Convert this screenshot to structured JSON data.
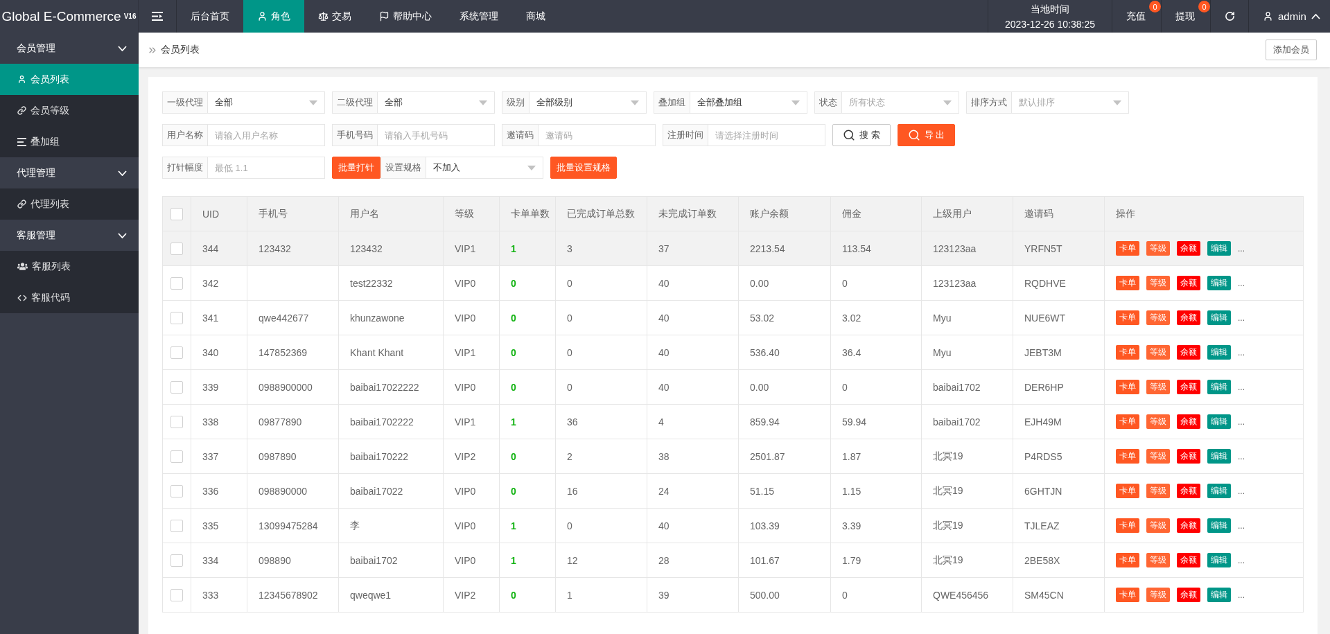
{
  "header": {
    "logo": "Global E-Commerce",
    "version": "V16",
    "nav": [
      {
        "label": "后台首页",
        "selected": false
      },
      {
        "label": "角色",
        "selected": true
      },
      {
        "label": "交易",
        "selected": false
      },
      {
        "label": "帮助中心",
        "selected": false
      },
      {
        "label": "系统管理",
        "selected": false
      },
      {
        "label": "商城",
        "selected": false
      }
    ],
    "clock": {
      "label": "当地时间",
      "time": "2023-12-26 10:38:25"
    },
    "links": [
      {
        "label": "充值",
        "badge": "0"
      },
      {
        "label": "提现",
        "badge": "0"
      }
    ],
    "user": "admin"
  },
  "sidebar": [
    {
      "label": "会员管理",
      "expanded": true,
      "children": [
        {
          "label": "会员列表",
          "selected": true
        },
        {
          "label": "会员等级",
          "selected": false
        },
        {
          "label": "叠加组",
          "selected": false
        }
      ]
    },
    {
      "label": "代理管理",
      "expanded": true,
      "children": [
        {
          "label": "代理列表",
          "selected": false
        }
      ]
    },
    {
      "label": "客服管理",
      "expanded": true,
      "children": [
        {
          "label": "客服列表",
          "selected": false
        },
        {
          "label": "客服代码",
          "selected": false
        }
      ]
    }
  ],
  "breadcrumb": {
    "current": "会员列表",
    "add_button": "添加会员"
  },
  "filters": [
    [
      {
        "kind": "select",
        "label": "一级代理",
        "value": "全部"
      },
      {
        "kind": "select",
        "label": "二级代理",
        "value": "全部"
      },
      {
        "kind": "select",
        "label": "级别",
        "value": "全部级别"
      },
      {
        "kind": "select",
        "label": "叠加组",
        "value": "全部叠加组"
      },
      {
        "kind": "select",
        "label": "状态",
        "placeholder": "所有状态"
      },
      {
        "kind": "select",
        "label": "排序方式",
        "placeholder": "默认排序"
      }
    ],
    [
      {
        "kind": "input",
        "label": "用户名称",
        "placeholder": "请输入用户名称"
      },
      {
        "kind": "input",
        "label": "手机号码",
        "placeholder": "请输入手机号码"
      },
      {
        "kind": "input",
        "label": "邀请码",
        "placeholder": "邀请码"
      },
      {
        "kind": "input",
        "label": "注册时间",
        "placeholder": "请选择注册时间"
      },
      {
        "kind": "plainbutton",
        "icon": true,
        "label": "搜 索"
      },
      {
        "kind": "button",
        "icon": true,
        "label": "导 出"
      }
    ],
    [
      {
        "kind": "input",
        "label": "打针幅度",
        "placeholder": "最低 1.1"
      },
      {
        "kind": "group",
        "items": [
          {
            "kind": "button",
            "label": "批量打针"
          },
          {
            "kind": "select",
            "label": "设置规格",
            "value": "不加入"
          }
        ]
      },
      {
        "kind": "button",
        "label": "批量设置规格"
      }
    ]
  ],
  "table": {
    "header_checked": false,
    "columns": [
      "UID",
      "手机号",
      "用户名",
      "等级",
      "卡单单数",
      "已完成订单总数",
      "未完成订单数",
      "账户余额",
      "佣金",
      "上级用户",
      "邀请码",
      "操作"
    ],
    "rows": [
      {
        "checked": false,
        "highlighted": true,
        "uid": "344",
        "phone": "123432",
        "username": "123432",
        "level": "VIP1",
        "stuck": "1",
        "done": "3",
        "pending": "37",
        "balance": "2213.54",
        "commission": "113.54",
        "parent": "123123aa",
        "invite": "YRFN5T",
        "actions": [
          {
            "label": "卡单",
            "color": "#ff5722"
          },
          {
            "label": "等级",
            "color": "#ff6633"
          },
          {
            "label": "余额",
            "color": "#ff0000"
          },
          {
            "label": "编辑",
            "color": "#009688"
          }
        ],
        "more": "..."
      },
      {
        "checked": false,
        "highlighted": false,
        "uid": "342",
        "username": "test22332",
        "level": "VIP0",
        "stuck": "0",
        "done": "0",
        "pending": "40",
        "balance": "0.00",
        "commission": "0",
        "parent": "123123aa",
        "invite": "RQDHVE",
        "actions": [
          {
            "label": "卡单",
            "color": "#ff5722"
          },
          {
            "label": "等级",
            "color": "#ff6633"
          },
          {
            "label": "余额",
            "color": "#ff0000"
          },
          {
            "label": "编辑",
            "color": "#009688"
          }
        ],
        "more": "..."
      },
      {
        "checked": false,
        "highlighted": false,
        "uid": "341",
        "phone": "qwe442677",
        "username": "khunzawone",
        "level": "VIP0",
        "stuck": "0",
        "done": "0",
        "pending": "40",
        "balance": "53.02",
        "commission": "3.02",
        "parent": "Myu",
        "invite": "NUE6WT",
        "actions": [
          {
            "label": "卡单",
            "color": "#ff5722"
          },
          {
            "label": "等级",
            "color": "#ff6633"
          },
          {
            "label": "余额",
            "color": "#ff0000"
          },
          {
            "label": "编辑",
            "color": "#009688"
          }
        ],
        "more": "..."
      },
      {
        "checked": false,
        "highlighted": false,
        "uid": "340",
        "phone": "147852369",
        "username": "Khant Khant",
        "level": "VIP1",
        "stuck": "0",
        "done": "0",
        "pending": "40",
        "balance": "536.40",
        "commission": "36.4",
        "parent": "Myu",
        "invite": "JEBT3M",
        "actions": [
          {
            "label": "卡单",
            "color": "#ff5722"
          },
          {
            "label": "等级",
            "color": "#ff6633"
          },
          {
            "label": "余额",
            "color": "#ff0000"
          },
          {
            "label": "编辑",
            "color": "#009688"
          }
        ],
        "more": "..."
      },
      {
        "checked": false,
        "highlighted": false,
        "uid": "339",
        "phone": "0988900000",
        "username": "baibai17022222",
        "level": "VIP0",
        "stuck": "0",
        "done": "0",
        "pending": "40",
        "balance": "0.00",
        "commission": "0",
        "parent": "baibai1702",
        "invite": "DER6HP",
        "actions": [
          {
            "label": "卡单",
            "color": "#ff5722"
          },
          {
            "label": "等级",
            "color": "#ff6633"
          },
          {
            "label": "余额",
            "color": "#ff0000"
          },
          {
            "label": "编辑",
            "color": "#009688"
          }
        ],
        "more": "..."
      },
      {
        "checked": false,
        "highlighted": false,
        "uid": "338",
        "phone": "09877890",
        "username": "baibai1702222",
        "level": "VIP1",
        "stuck": "1",
        "done": "36",
        "pending": "4",
        "balance": "859.94",
        "commission": "59.94",
        "parent": "baibai1702",
        "invite": "EJH49M",
        "actions": [
          {
            "label": "卡单",
            "color": "#ff5722"
          },
          {
            "label": "等级",
            "color": "#ff6633"
          },
          {
            "label": "余额",
            "color": "#ff0000"
          },
          {
            "label": "编辑",
            "color": "#009688"
          }
        ],
        "more": "..."
      },
      {
        "checked": false,
        "highlighted": false,
        "uid": "337",
        "phone": "0987890",
        "username": "baibai170222",
        "level": "VIP2",
        "stuck": "0",
        "done": "2",
        "pending": "38",
        "balance": "2501.87",
        "commission": "1.87",
        "parent": "北冥19",
        "invite": "P4RDS5",
        "actions": [
          {
            "label": "卡单",
            "color": "#ff5722"
          },
          {
            "label": "等级",
            "color": "#ff6633"
          },
          {
            "label": "余额",
            "color": "#ff0000"
          },
          {
            "label": "编辑",
            "color": "#009688"
          }
        ],
        "more": "..."
      },
      {
        "checked": false,
        "highlighted": false,
        "uid": "336",
        "phone": "098890000",
        "username": "baibai17022",
        "level": "VIP0",
        "stuck": "0",
        "done": "16",
        "pending": "24",
        "balance": "51.15",
        "commission": "1.15",
        "parent": "北冥19",
        "invite": "6GHTJN",
        "actions": [
          {
            "label": "卡单",
            "color": "#ff5722"
          },
          {
            "label": "等级",
            "color": "#ff6633"
          },
          {
            "label": "余额",
            "color": "#ff0000"
          },
          {
            "label": "编辑",
            "color": "#009688"
          }
        ],
        "more": "..."
      },
      {
        "checked": false,
        "highlighted": false,
        "uid": "335",
        "phone": "13099475284",
        "username": "李",
        "level": "VIP0",
        "stuck": "1",
        "done": "0",
        "pending": "40",
        "balance": "103.39",
        "commission": "3.39",
        "parent": "北冥19",
        "invite": "TJLEAZ",
        "actions": [
          {
            "label": "卡单",
            "color": "#ff5722"
          },
          {
            "label": "等级",
            "color": "#ff6633"
          },
          {
            "label": "余额",
            "color": "#ff0000"
          },
          {
            "label": "编辑",
            "color": "#009688"
          }
        ],
        "more": "..."
      },
      {
        "checked": false,
        "highlighted": false,
        "uid": "334",
        "phone": "098890",
        "username": "baibai1702",
        "level": "VIP0",
        "stuck": "1",
        "done": "12",
        "pending": "28",
        "balance": "101.67",
        "commission": "1.79",
        "parent": "北冥19",
        "invite": "2BE58X",
        "actions": [
          {
            "label": "卡单",
            "color": "#ff5722"
          },
          {
            "label": "等级",
            "color": "#ff6633"
          },
          {
            "label": "余额",
            "color": "#ff0000"
          },
          {
            "label": "编辑",
            "color": "#009688"
          }
        ],
        "more": "..."
      },
      {
        "checked": false,
        "highlighted": false,
        "uid": "333",
        "phone": "12345678902",
        "username": "qweqwe1",
        "level": "VIP2",
        "stuck": "0",
        "done": "1",
        "pending": "39",
        "balance": "500.00",
        "commission": "0",
        "parent": "QWE456456",
        "invite": "SM45CN",
        "actions": [
          {
            "label": "卡单",
            "color": "#ff5722"
          },
          {
            "label": "等级",
            "color": "#ff6633"
          },
          {
            "label": "余额",
            "color": "#ff0000"
          },
          {
            "label": "编辑",
            "color": "#009688"
          }
        ],
        "more": "..."
      }
    ]
  }
}
